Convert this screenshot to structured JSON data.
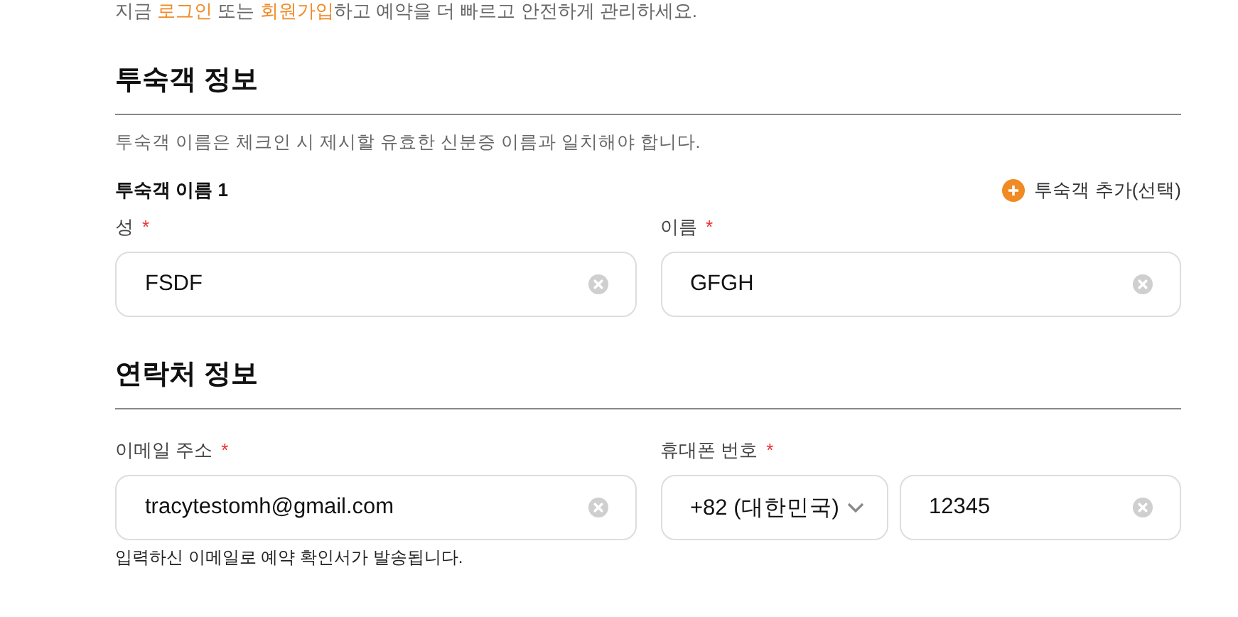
{
  "notice": [
    {
      "kind": "text",
      "text": "지금 "
    },
    {
      "kind": "link",
      "text": "로그인"
    },
    {
      "kind": "text",
      "text": " 또는 "
    },
    {
      "kind": "link",
      "text": "회원가입"
    },
    {
      "kind": "text",
      "text": "하고 예약을 더 빠르고 안전하게 관리하세요."
    }
  ],
  "guest_section": {
    "title": "투숙객 정보",
    "hint": "투숙객 이름은 체크인 시 제시할 유효한 신분증 이름과 일치해야 합니다.",
    "guest_label": "투숙객 이름 1",
    "add_guest": "투숙객 추가(선택)",
    "fields": [
      {
        "label": "성",
        "required_mark": "*",
        "value": "FSDF"
      },
      {
        "label": "이름",
        "required_mark": "*",
        "value": "GFGH"
      }
    ]
  },
  "contact_section": {
    "title": "연락처 정보",
    "email": {
      "label": "이메일 주소",
      "required_mark": "*",
      "value": "tracytestomh@gmail.com",
      "note": "입력하신 이메일로 예약 확인서가 발송됩니다."
    },
    "phone": {
      "label": "휴대폰 번호",
      "required_mark": "*",
      "country_code": "+82 (대한민국)",
      "value": "12345"
    }
  }
}
